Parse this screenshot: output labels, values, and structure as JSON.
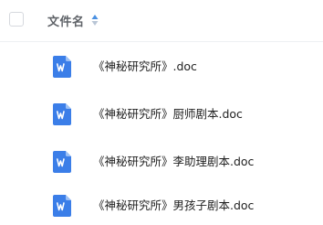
{
  "header": {
    "column_name": "文件名",
    "sort_icon": "sort-icon",
    "sort_colors": {
      "up": "#4a90e2",
      "down": "#b9c6d6"
    }
  },
  "files": [
    {
      "name": "《神秘研究所》.doc",
      "icon": "word-doc-icon"
    },
    {
      "name": "《神秘研究所》厨师剧本.doc",
      "icon": "word-doc-icon"
    },
    {
      "name": "《神秘研究所》李助理剧本.doc",
      "icon": "word-doc-icon"
    },
    {
      "name": "《神秘研究所》男孩子剧本.doc",
      "icon": "word-doc-icon"
    }
  ],
  "colors": {
    "word_icon": "#3b7ee8",
    "word_icon_fold": "#9cc0f5"
  }
}
